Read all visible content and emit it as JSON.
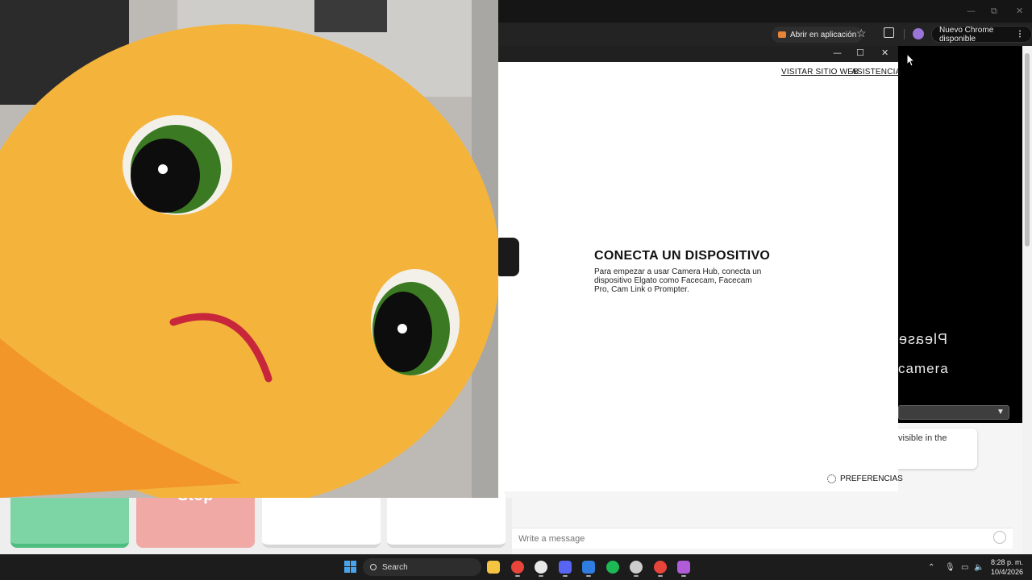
{
  "chrome": {
    "open_in_app": "Abrir en aplicación",
    "update_label": "Nuevo Chrome disponible",
    "window_controls": {
      "minimize": "—",
      "restore": "⧉",
      "close": "✕"
    }
  },
  "web": {
    "mirrored_line1": "Please",
    "mirrored_line2": "camera",
    "card_text": "visible in the",
    "message_placeholder": "Write a message",
    "stop_label": "Stop"
  },
  "camera_hub": {
    "link_website": "VISITAR SITIO WEB",
    "link_support": "ASISTENCIA",
    "connect_title": "CONECTA UN DISPOSITIVO",
    "connect_description": "Para empezar a usar Camera Hub, conecta un dispositivo Elgato como Facecam, Facecam Pro, Cam Link o Prompter.",
    "preferences": "PREFERENCIAS",
    "window_controls": {
      "minimize": "—",
      "maximize": "☐",
      "close": "✕"
    }
  },
  "taskbar": {
    "search_label": "Search",
    "time": "8:28 p. m.",
    "date": "10/4/2026",
    "apps": [
      "file-explorer",
      "chrome",
      "chatgpt",
      "discord",
      "edge-app",
      "spotify",
      "app-badge",
      "chrome-profile",
      "camera-hub"
    ],
    "app_colors": [
      "#f5c542",
      "#e7443a",
      "#e8e8e8",
      "#5865f2",
      "#2f7de1",
      "#1db954",
      "#cccccc",
      "#e7443a",
      "#b05cd8"
    ]
  },
  "colors": {
    "tile_green": "#7dd4a5",
    "tile_red": "#f0a9a5",
    "plush_yellow": "#f4b43c"
  }
}
